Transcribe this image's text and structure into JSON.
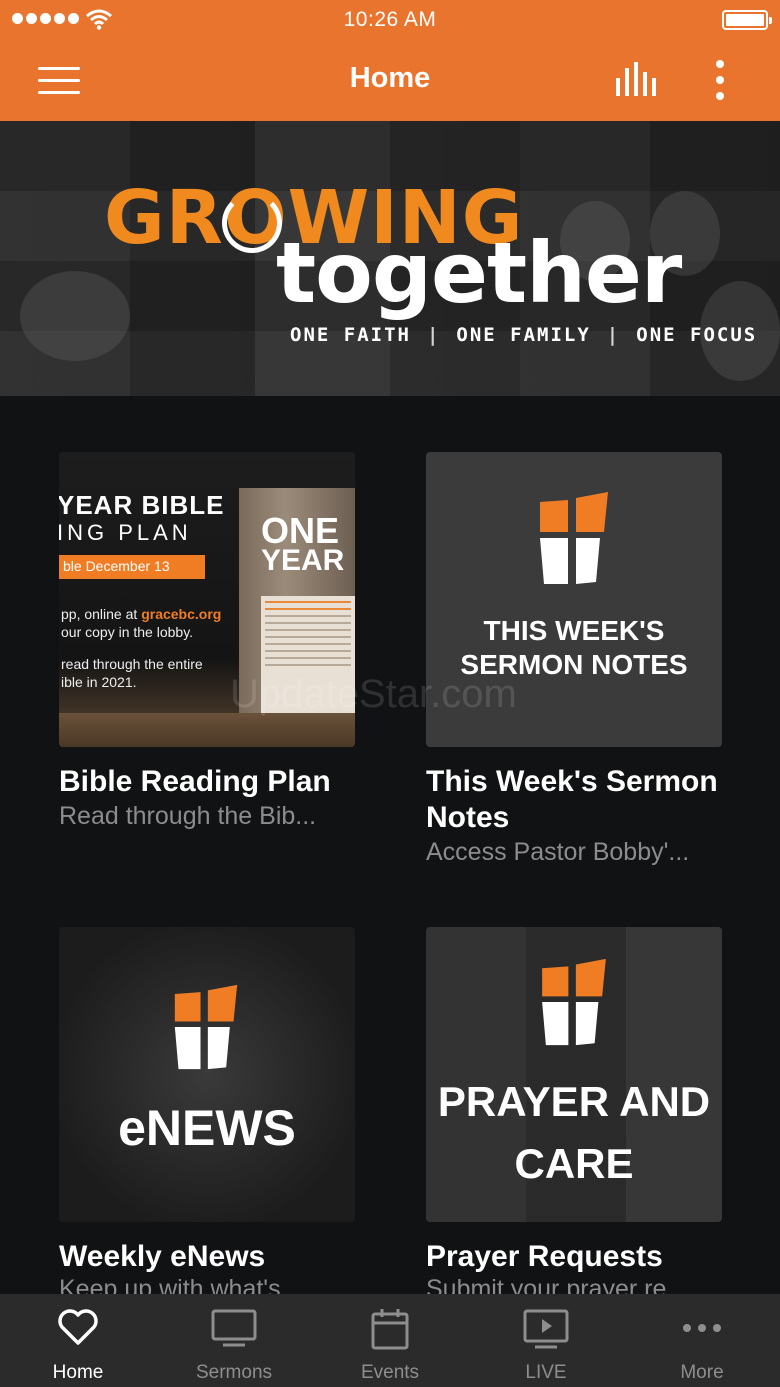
{
  "status_bar": {
    "time": "10:26 AM"
  },
  "nav": {
    "title": "Home"
  },
  "hero": {
    "growing": "GROWING",
    "together": "together",
    "tagline": [
      "ONE FAITH",
      "ONE FAMILY",
      "ONE FOCUS"
    ]
  },
  "cards": [
    {
      "title": "Bible Reading Plan",
      "subtitle": "Read through the Bib...",
      "thumb": {
        "line1": "YEAR BIBLE",
        "line2": "ING PLAN",
        "date": "ble December 13",
        "info_a": "pp, online at",
        "info_link": "gracebc.org",
        "info_b": "our copy in the lobby.",
        "info_c": "read through the entire",
        "info_d": "ible in 2021.",
        "book_one": "ONE",
        "book_year": "YEAR"
      }
    },
    {
      "title": "This Week's Sermon Notes",
      "subtitle": "Access Pastor Bobby'...",
      "thumb": {
        "label_1": "THIS WEEK'S",
        "label_2": "SERMON NOTES"
      }
    },
    {
      "title": "Weekly eNews",
      "subtitle": "Keep up with what's",
      "thumb": {
        "label": "eNEWS"
      }
    },
    {
      "title": "Prayer Requests",
      "subtitle": "Submit your prayer re",
      "thumb": {
        "label_1": "PRAYER AND",
        "label_2": "CARE"
      }
    }
  ],
  "watermark": "UpdateStar.com",
  "tabs": [
    {
      "label": "Home",
      "icon": "heart-icon",
      "active": true
    },
    {
      "label": "Sermons",
      "icon": "monitor-icon",
      "active": false
    },
    {
      "label": "Events",
      "icon": "calendar-icon",
      "active": false
    },
    {
      "label": "LIVE",
      "icon": "tv-play-icon",
      "active": false
    },
    {
      "label": "More",
      "icon": "ellipsis-icon",
      "active": false
    }
  ],
  "colors": {
    "brand_orange": "#e8742e",
    "logo_orange": "#f08a1e",
    "background": "#111214",
    "tab_bar": "#2b2b2c"
  }
}
